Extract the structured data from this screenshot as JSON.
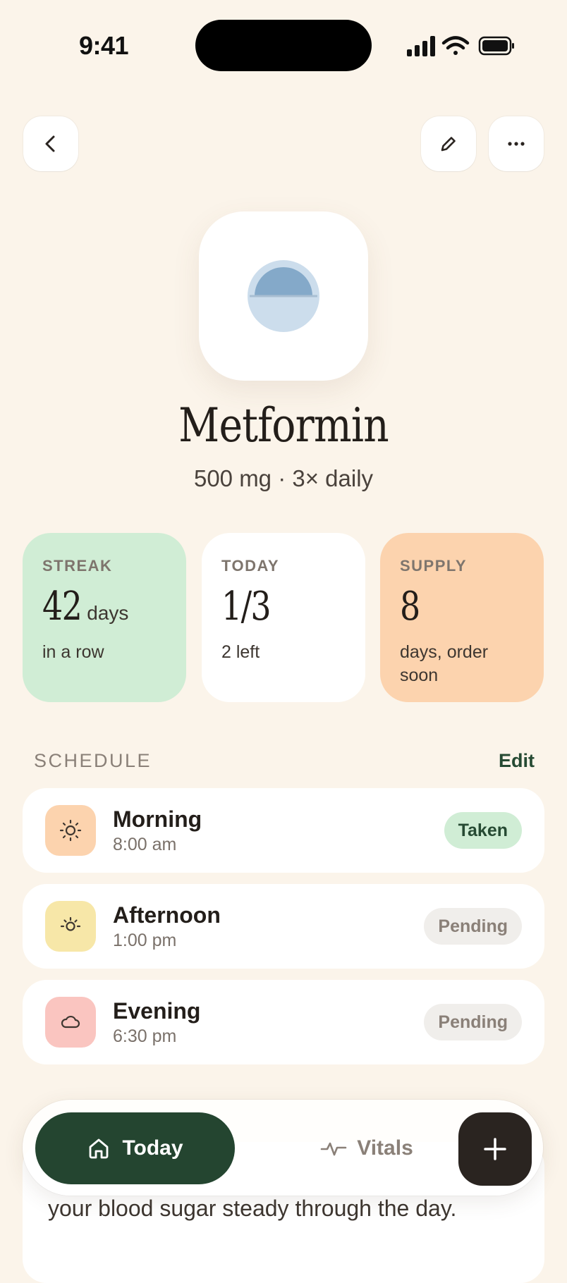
{
  "status_bar": {
    "time": "9:41"
  },
  "header": {
    "back_icon": "chevron-left-icon",
    "edit_icon": "pencil-icon",
    "more_icon": "ellipsis-icon"
  },
  "medication": {
    "name": "Metformin",
    "dose": "500 mg · 3× daily",
    "icon": "pill-icon"
  },
  "stats": [
    {
      "label": "STREAK",
      "value": "42",
      "unit": "days",
      "note": "in a row",
      "color": "#D0EDD5"
    },
    {
      "label": "TODAY",
      "value": "1/3",
      "unit": "",
      "note": "2 left",
      "color": "#FFFFFF"
    },
    {
      "label": "SUPPLY",
      "value": "8",
      "unit": "",
      "note": "days, order soon",
      "color": "#FCD3AE"
    }
  ],
  "schedule": {
    "title": "SCHEDULE",
    "edit_label": "Edit",
    "items": [
      {
        "name": "Morning",
        "time": "8:00 am",
        "status": "Taken",
        "icon": "sun-icon",
        "icon_bg": "#FCD3AE"
      },
      {
        "name": "Afternoon",
        "time": "1:00 pm",
        "status": "Pending",
        "icon": "sun-low-icon",
        "icon_bg": "#F7E7A8"
      },
      {
        "name": "Evening",
        "time": "6:30 pm",
        "status": "Pending",
        "icon": "cloud-icon",
        "icon_bg": "#FAC5C0"
      }
    ]
  },
  "note_peek": "your blood sugar steady through the day.",
  "tabbar": {
    "today_label": "Today",
    "vitals_label": "Vitals",
    "add_icon": "plus-icon"
  },
  "colors": {
    "background": "#FBF4EA",
    "accent": "#244530",
    "dark": "#2A2420"
  }
}
